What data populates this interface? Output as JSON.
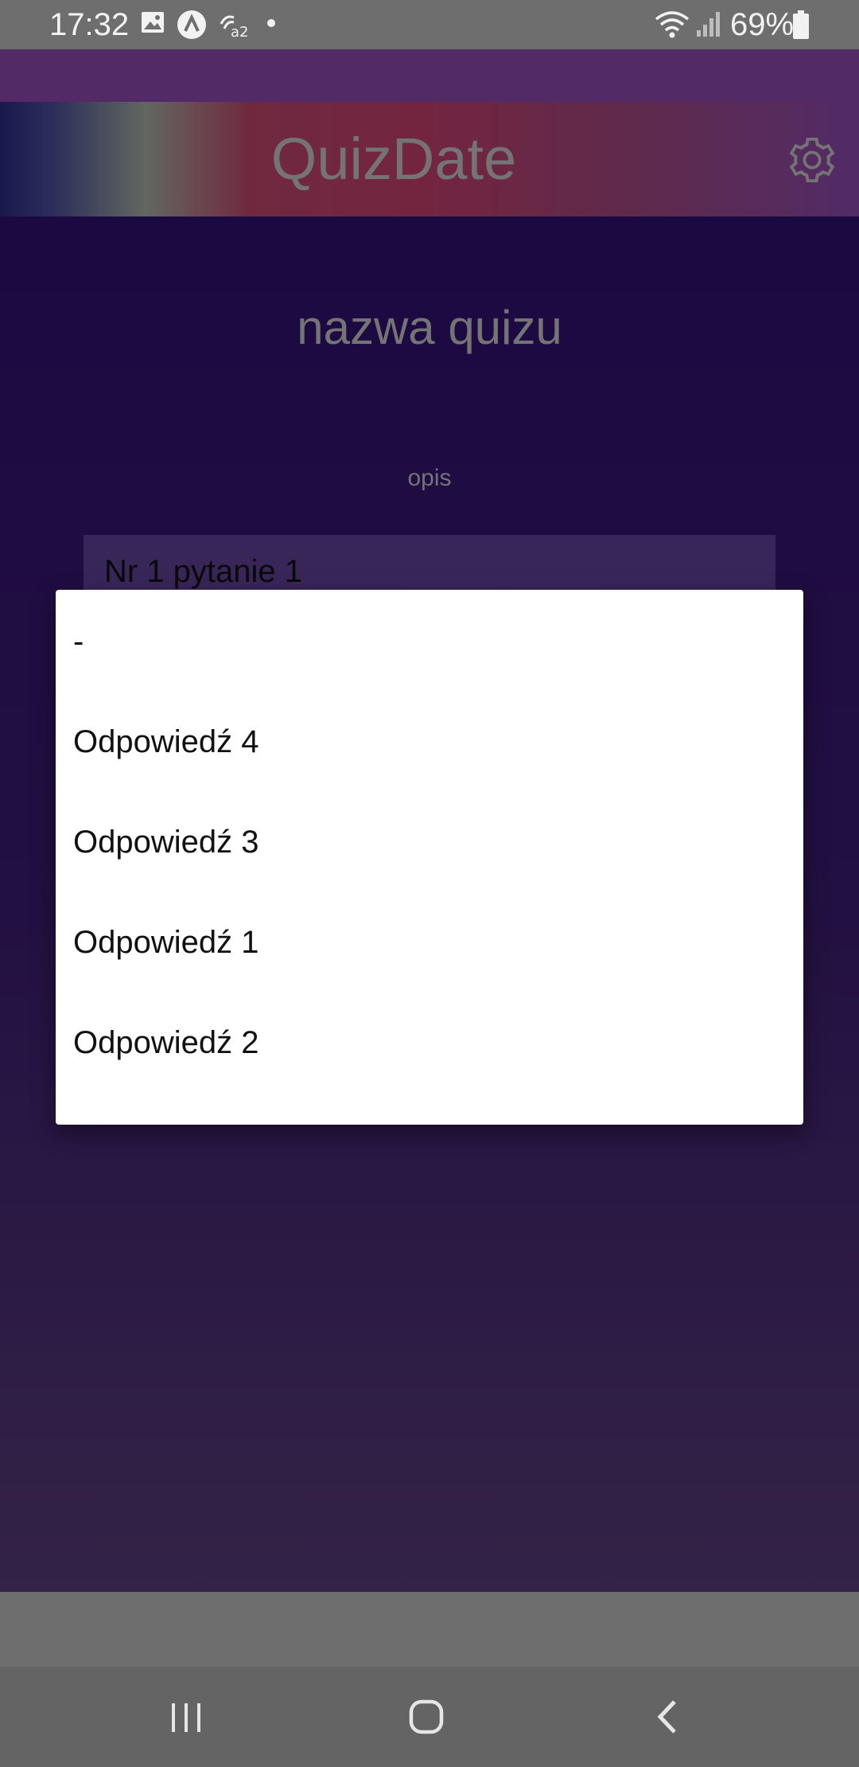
{
  "status_bar": {
    "time": "17:32",
    "battery": "69%",
    "icons": [
      "image-icon",
      "app-a-icon",
      "nfc-icon",
      "wifi-icon",
      "signal-icon",
      "battery-icon"
    ]
  },
  "header": {
    "title": "QuizDate",
    "settings_icon": "gear-icon"
  },
  "quiz": {
    "name": "nazwa quizu",
    "description": "opis",
    "question_label": "Nr 1 pytanie 1"
  },
  "dialog": {
    "options": [
      {
        "label": "-"
      },
      {
        "label": "Odpowiedź 4"
      },
      {
        "label": "Odpowiedź 3"
      },
      {
        "label": "Odpowiedź 1"
      },
      {
        "label": "Odpowiedź 2"
      }
    ]
  },
  "nav_bar": {
    "buttons": [
      "recent-apps-icon",
      "home-icon",
      "back-icon"
    ]
  },
  "colors": {
    "status_bar": "#6e6e6e",
    "background_top": "#2d0d73",
    "background_bottom": "#5a3d7a",
    "dialog_bg": "#ffffff",
    "dialog_text": "#111111"
  }
}
